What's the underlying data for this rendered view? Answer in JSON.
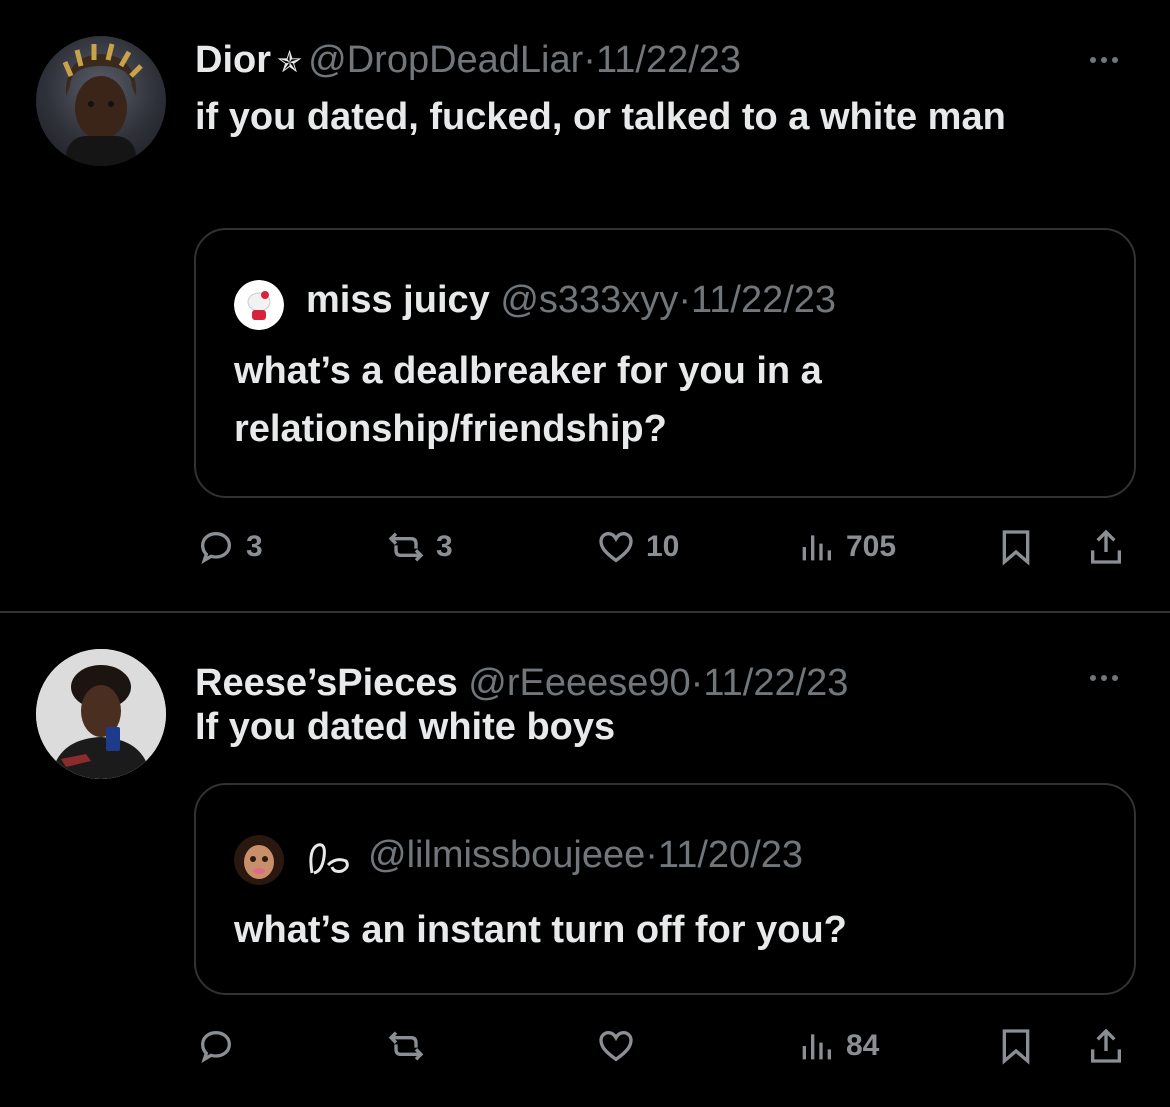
{
  "tweets": [
    {
      "author_name": "Dior",
      "badge": "✯",
      "handle": "@DropDeadLiar",
      "separator": "·",
      "date": "11/22/23",
      "text": "if you dated, fucked, or talked to a white man",
      "quote": {
        "author_name": "miss juicy",
        "handle": "@s333xyy",
        "separator": "·",
        "date": "11/22/23",
        "text": "what’s a dealbreaker for you in a relationship/friendship?"
      },
      "actions": {
        "replies": "3",
        "retweets": "3",
        "likes": "10",
        "views": "705"
      }
    },
    {
      "author_name": "Reese’sPieces",
      "handle": "@rEeeese90",
      "separator": "·",
      "date": "11/22/23",
      "text": "If you dated white boys",
      "quote": {
        "author_name": "",
        "handle": "@lilmissboujeee",
        "separator": "·",
        "date": "11/20/23",
        "text": "what’s an instant turn off for you?"
      },
      "actions": {
        "replies": "",
        "retweets": "",
        "likes": "",
        "views": "84"
      }
    }
  ],
  "colors": {
    "background": "#000000",
    "text": "#e7e9ea",
    "muted": "#71767b",
    "border": "#2f3336"
  },
  "icons": [
    "reply-icon",
    "retweet-icon",
    "like-icon",
    "views-icon",
    "bookmark-icon",
    "share-icon",
    "more-icon"
  ]
}
